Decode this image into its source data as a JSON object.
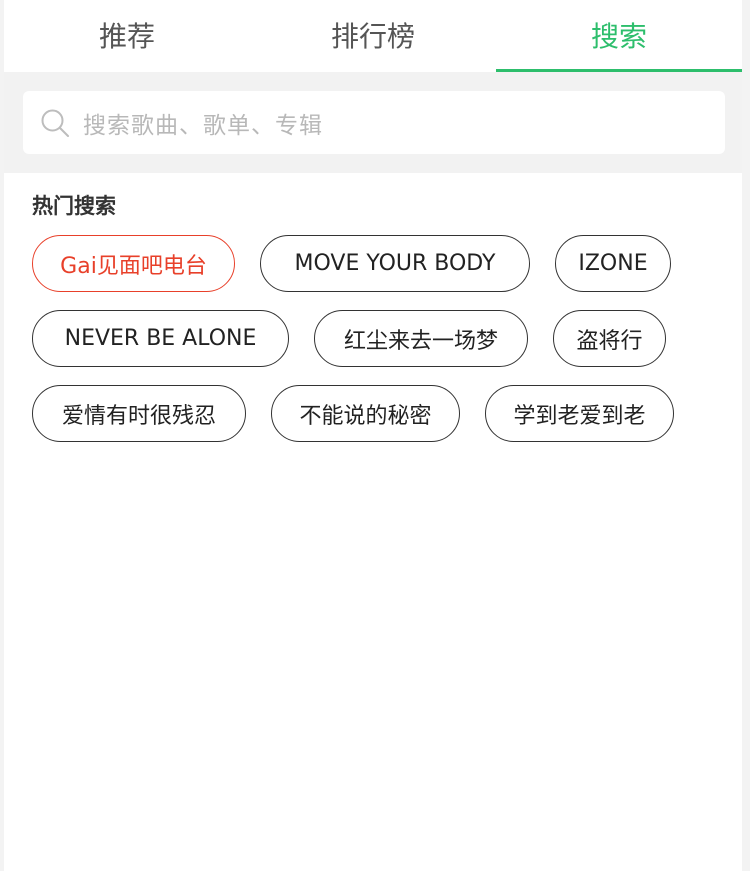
{
  "tabs": [
    {
      "label": "推荐",
      "active": false
    },
    {
      "label": "排行榜",
      "active": false
    },
    {
      "label": "搜索",
      "active": true
    }
  ],
  "search": {
    "placeholder": "搜索歌曲、歌单、专辑",
    "icon": "search-icon"
  },
  "hot": {
    "title": "热门搜索",
    "tags": [
      [
        "Gai见面吧电台",
        "MOVE YOUR BODY",
        "IZONE"
      ],
      [
        "NEVER BE ALONE",
        "红尘来去一场梦",
        "盗将行"
      ],
      [
        "爱情有时很残忍",
        "不能说的秘密",
        "学到老爱到老"
      ]
    ]
  },
  "colors": {
    "accent": "#2dbe6c",
    "highlight_tag": "#e8402a",
    "tag_border": "#333333"
  }
}
